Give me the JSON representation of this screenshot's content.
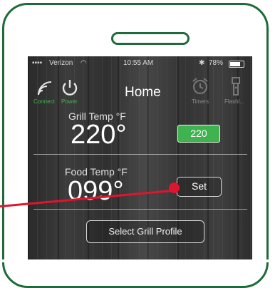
{
  "status_bar": {
    "carrier": "Verizon",
    "time": "10:55 AM",
    "battery": "78%"
  },
  "nav": {
    "title": "Home",
    "connect_label": "Connect",
    "power_label": "Power",
    "timers_label": "Timers",
    "flash_label": "Flashl..."
  },
  "grill": {
    "label": "Grill Temp °F",
    "value": "220°",
    "setpoint": "220"
  },
  "food": {
    "label": "Food Temp °F",
    "value": "099°",
    "set_label": "Set"
  },
  "profile_button_label": "Select Grill Profile",
  "colors": {
    "frame": "#1e6b3a",
    "accent_green": "#3fb34f",
    "pointer_red": "#e0142d"
  }
}
